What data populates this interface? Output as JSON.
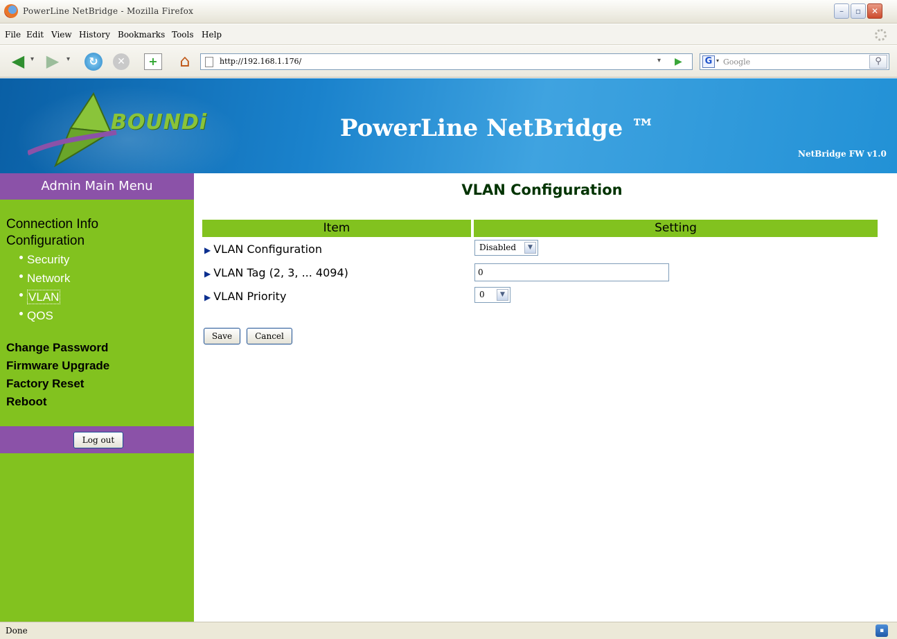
{
  "window": {
    "title": "PowerLine NetBridge - Mozilla Firefox",
    "controls": {
      "minimize": "–",
      "maximize": "▫",
      "close": "✕"
    }
  },
  "menubar": {
    "items": [
      "File",
      "Edit",
      "View",
      "History",
      "Bookmarks",
      "Tools",
      "Help"
    ]
  },
  "toolbar": {
    "back_icon": "back-arrow-icon",
    "forward_icon": "forward-arrow-icon",
    "url": "http://192.168.1.176/",
    "search_placeholder": "Google",
    "search_engine_letter": "G"
  },
  "banner": {
    "logo_text": "BOUNDi",
    "title": "PowerLine NetBridge ™",
    "fw_label": "NetBridge FW v1.0",
    "colors": {
      "banner": "#1a82cc",
      "logo_green": "#8ac43a"
    }
  },
  "sidebar": {
    "header": "Admin Main Menu",
    "connection_info": "Connection Info",
    "configuration": "Configuration",
    "sub_items": [
      "Security",
      "Network",
      "VLAN",
      "QOS"
    ],
    "active_sub_item": "VLAN",
    "actions": [
      "Change Password",
      "Firmware Upgrade",
      "Factory Reset",
      "Reboot"
    ],
    "logout_label": "Log out",
    "colors": {
      "menu_green": "#82c21f",
      "menu_purple": "#8b52a8"
    }
  },
  "main": {
    "page_title": "VLAN Configuration",
    "table": {
      "headers": {
        "item": "Item",
        "setting": "Setting"
      },
      "rows": [
        {
          "label": "VLAN Configuration",
          "type": "select",
          "value": "Disabled"
        },
        {
          "label": "VLAN Tag (2, 3, ... 4094)",
          "type": "text",
          "value": "0"
        },
        {
          "label": "VLAN Priority",
          "type": "select",
          "value": "0"
        }
      ]
    },
    "save_label": "Save",
    "cancel_label": "Cancel"
  },
  "statusbar": {
    "status_text": "Done"
  }
}
